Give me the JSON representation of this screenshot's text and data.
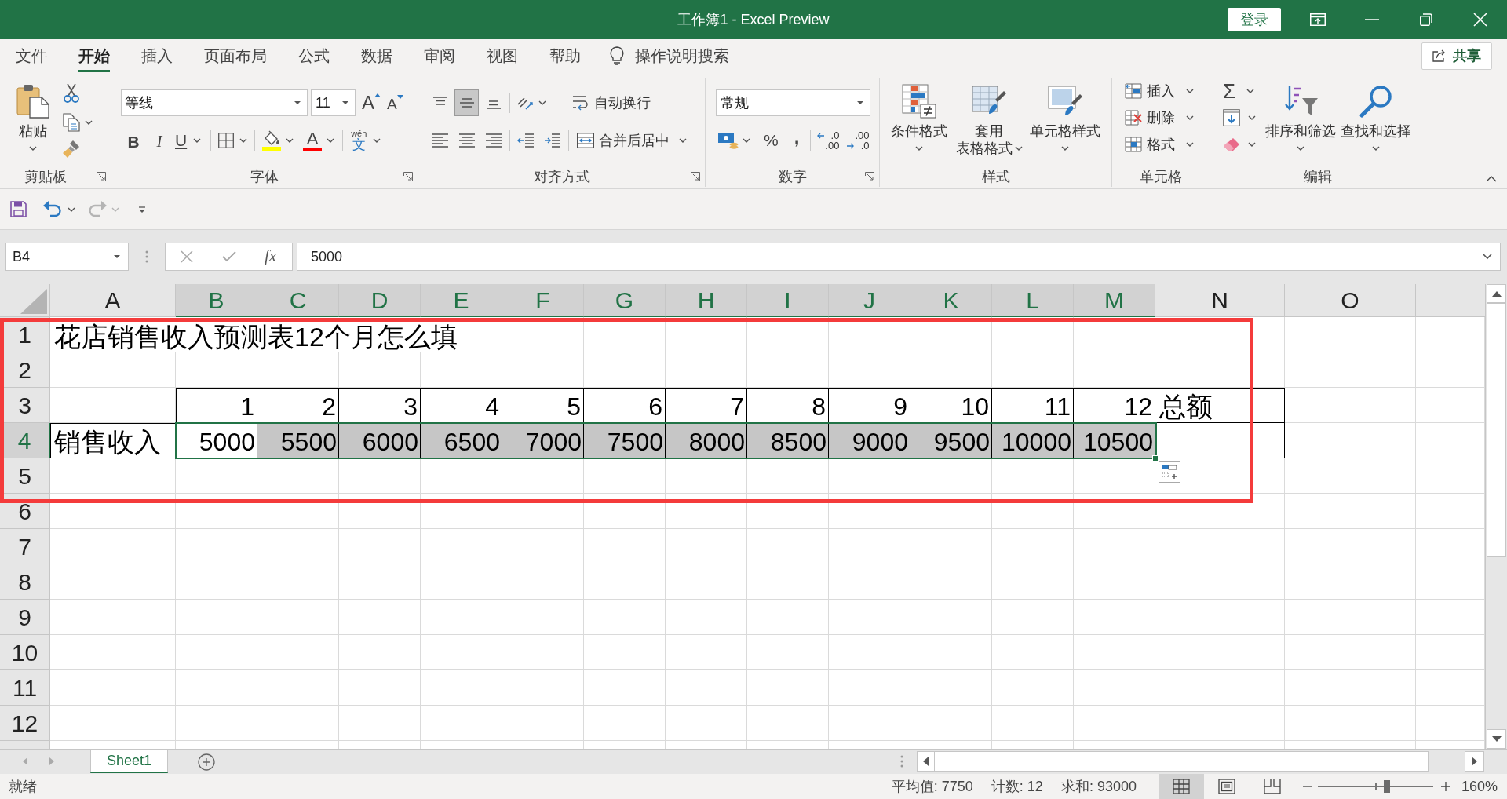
{
  "window": {
    "title": "工作簿1 - Excel Preview",
    "sign_in": "登录"
  },
  "menu_tabs": [
    {
      "label": "文件",
      "selected": false
    },
    {
      "label": "开始",
      "selected": true
    },
    {
      "label": "插入",
      "selected": false
    },
    {
      "label": "页面布局",
      "selected": false
    },
    {
      "label": "公式",
      "selected": false
    },
    {
      "label": "数据",
      "selected": false
    },
    {
      "label": "审阅",
      "selected": false
    },
    {
      "label": "视图",
      "selected": false
    },
    {
      "label": "帮助",
      "selected": false
    }
  ],
  "tell_me": {
    "placeholder": "操作说明搜索"
  },
  "share": "共享",
  "ribbon": {
    "clipboard": {
      "label": "剪贴板",
      "paste": "粘贴"
    },
    "font": {
      "label": "字体",
      "font_name": "等线",
      "font_size": "11",
      "grow": "A",
      "shrink": "A",
      "bold": "B",
      "italic": "I",
      "underline": "U",
      "font_color": "A",
      "phonetic": "wén",
      "phonetic_char": "文"
    },
    "alignment": {
      "label": "对齐方式",
      "vertical": [
        {
          "kind": "top",
          "selected": false
        },
        {
          "kind": "middle",
          "selected": true
        },
        {
          "kind": "bottom",
          "selected": false
        }
      ],
      "horizontal": [
        {
          "kind": "left",
          "selected": false
        },
        {
          "kind": "center",
          "selected": false
        },
        {
          "kind": "right",
          "selected": false
        }
      ],
      "wrap_text": "自动换行",
      "merge_center": "合并后居中"
    },
    "number": {
      "label": "数字",
      "format": "常规",
      "percent": "%",
      "comma": ",",
      "increase_decimal": [
        ".0",
        ".00"
      ],
      "decrease_decimal": [
        ".00",
        ".0"
      ]
    },
    "styles": {
      "label": "样式",
      "buttons": [
        {
          "kind": "conditional",
          "lines": [
            "条件格式"
          ]
        },
        {
          "kind": "table",
          "lines": [
            "套用",
            "表格格式"
          ]
        },
        {
          "kind": "cell",
          "lines": [
            "单元格样式"
          ]
        }
      ]
    },
    "cells": {
      "label": "单元格",
      "buttons": [
        {
          "kind": "insert",
          "label": "插入"
        },
        {
          "kind": "delete",
          "label": "删除"
        },
        {
          "kind": "format",
          "label": "格式"
        }
      ]
    },
    "editing": {
      "label": "编辑",
      "autosum": "Σ",
      "sort_filter": "排序和筛选",
      "find_select": "查找和选择"
    }
  },
  "quick_access": [
    {
      "kind": "save",
      "disabled": false
    },
    {
      "kind": "undo",
      "disabled": false
    },
    {
      "kind": "redo",
      "disabled": true
    }
  ],
  "formula_bar": {
    "name_box": "B4",
    "fx": "fx",
    "value": "5000"
  },
  "sheet": {
    "columns": [
      {
        "label": "A",
        "selected": false
      },
      {
        "label": "B",
        "selected": true
      },
      {
        "label": "C",
        "selected": true
      },
      {
        "label": "D",
        "selected": true
      },
      {
        "label": "E",
        "selected": true
      },
      {
        "label": "F",
        "selected": true
      },
      {
        "label": "G",
        "selected": true
      },
      {
        "label": "H",
        "selected": true
      },
      {
        "label": "I",
        "selected": true
      },
      {
        "label": "J",
        "selected": true
      },
      {
        "label": "K",
        "selected": true
      },
      {
        "label": "L",
        "selected": true
      },
      {
        "label": "M",
        "selected": true
      },
      {
        "label": "N",
        "selected": false
      },
      {
        "label": "O",
        "selected": false
      }
    ],
    "rows": [
      {
        "label": "1",
        "selected": false
      },
      {
        "label": "2",
        "selected": false
      },
      {
        "label": "3",
        "selected": false
      },
      {
        "label": "4",
        "selected": true
      },
      {
        "label": "5",
        "selected": false
      },
      {
        "label": "6",
        "selected": false
      },
      {
        "label": "7",
        "selected": false
      },
      {
        "label": "8",
        "selected": false
      },
      {
        "label": "9",
        "selected": false
      },
      {
        "label": "10",
        "selected": false
      },
      {
        "label": "11",
        "selected": false
      },
      {
        "label": "12",
        "selected": false
      }
    ],
    "title": "花店销售收入预测表12个月怎么填",
    "header_row": {
      "months": [
        "1",
        "2",
        "3",
        "4",
        "5",
        "6",
        "7",
        "8",
        "9",
        "10",
        "11",
        "12"
      ],
      "total": "总额"
    },
    "data_row": {
      "label": "销售收入",
      "values": [
        {
          "text": "5000",
          "selected": false
        },
        {
          "text": "5500",
          "selected": true
        },
        {
          "text": "6000",
          "selected": true
        },
        {
          "text": "6500",
          "selected": true
        },
        {
          "text": "7000",
          "selected": true
        },
        {
          "text": "7500",
          "selected": true
        },
        {
          "text": "8000",
          "selected": true
        },
        {
          "text": "8500",
          "selected": true
        },
        {
          "text": "9000",
          "selected": true
        },
        {
          "text": "9500",
          "selected": true
        },
        {
          "text": "10000",
          "selected": true
        },
        {
          "text": "10500",
          "selected": true
        }
      ]
    }
  },
  "sheet_tabs": [
    {
      "label": "Sheet1",
      "selected": true
    }
  ],
  "status_bar": {
    "status": "就绪",
    "average": "平均值: 7750",
    "count": "计数: 12",
    "sum": "求和: 93000",
    "views": [
      {
        "kind": "normal",
        "selected": true
      },
      {
        "kind": "page_layout",
        "selected": false
      },
      {
        "kind": "page_break",
        "selected": false
      }
    ],
    "zoom": {
      "level": 0.6,
      "reading": "160%"
    }
  }
}
